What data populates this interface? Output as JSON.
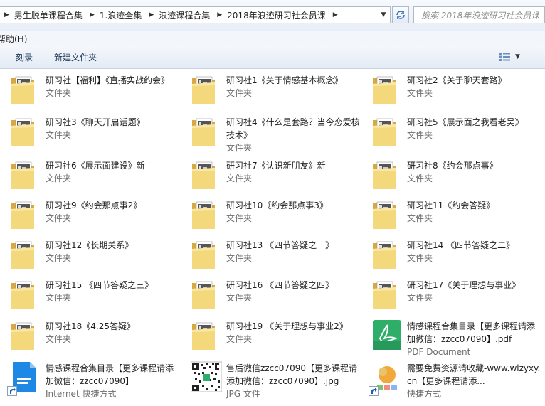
{
  "address_bar": {
    "crumbs": [
      "男生脱单课程合集",
      "1.浪迹全集",
      "浪迹课程合集",
      "2018年浪迹研习社会员课"
    ]
  },
  "search": {
    "placeholder": "搜索 2018年浪迹研习社会员课"
  },
  "menu": {
    "help_label": "帮助(H)"
  },
  "toolbar": {
    "burn_label": "刻录",
    "new_folder_label": "新建文件夹"
  },
  "folder_type": "文件夹",
  "items": [
    {
      "name": "研习社【福利】《直播实战约会》",
      "type": "文件夹",
      "icon": "folder-icon"
    },
    {
      "name": "研习社1《关于情感基本概念》",
      "type": "文件夹",
      "icon": "folder-icon"
    },
    {
      "name": "研习社2《关于聊天套路》",
      "type": "文件夹",
      "icon": "folder-icon"
    },
    {
      "name": "研习社3《聊天开启话题》",
      "type": "文件夹",
      "icon": "folder-icon"
    },
    {
      "name": "研习社4《什么是套路？当今恋爱核技术》",
      "type": "文件夹",
      "icon": "folder-icon"
    },
    {
      "name": "研习社5《展示面之我看老吴》",
      "type": "文件夹",
      "icon": "folder-icon"
    },
    {
      "name": "研习社6《展示面建设》新",
      "type": "文件夹",
      "icon": "folder-icon"
    },
    {
      "name": "研习社7《认识新朋友》新",
      "type": "文件夹",
      "icon": "folder-icon"
    },
    {
      "name": "研习社8《约会那点事》",
      "type": "文件夹",
      "icon": "folder-icon"
    },
    {
      "name": "研习社9《约会那点事2》",
      "type": "文件夹",
      "icon": "folder-icon"
    },
    {
      "name": "研习社10《约会那点事3》",
      "type": "文件夹",
      "icon": "folder-icon"
    },
    {
      "name": "研习社11《约会答疑》",
      "type": "文件夹",
      "icon": "folder-icon"
    },
    {
      "name": "研习社12《长期关系》",
      "type": "文件夹",
      "icon": "folder-icon"
    },
    {
      "name": "研习社13 《四节答疑之一》",
      "type": "文件夹",
      "icon": "folder-icon"
    },
    {
      "name": "研习社14 《四节答疑之二》",
      "type": "文件夹",
      "icon": "folder-icon"
    },
    {
      "name": "研习社15 《四节答疑之三》",
      "type": "文件夹",
      "icon": "folder-icon"
    },
    {
      "name": "研习社16 《四节答疑之四》",
      "type": "文件夹",
      "icon": "folder-icon"
    },
    {
      "name": "研习社17《关于理想与事业》",
      "type": "文件夹",
      "icon": "folder-icon"
    },
    {
      "name": "研习社18《4.25答疑》",
      "type": "文件夹",
      "icon": "folder-icon"
    },
    {
      "name": "研习社19 《关于理想与事业2》",
      "type": "文件夹",
      "icon": "folder-icon"
    },
    {
      "name": "情感课程合集目录【更多课程请添加微信：zzcc07090】.pdf",
      "type": "PDF Document",
      "icon": "pdf-icon"
    },
    {
      "name": "情感课程合集目录【更多课程请添加微信：zzcc07090】",
      "type": "Internet 快捷方式",
      "icon": "internet-shortcut-icon"
    },
    {
      "name": "售后微信zzcc07090【更多课程请添加微信：zzcc07090】.jpg",
      "type": "JPG 文件",
      "icon": "qr-image-icon"
    },
    {
      "name": "需要免费资源请收藏-www.wlzyxy.cn【更多课程请添...",
      "type": "快捷方式",
      "icon": "shortcut-icon"
    }
  ],
  "colors": {
    "folder": "#e8c46a",
    "pdf": "#28b06b",
    "internet": "#1e88e5",
    "accent": "#1e3557"
  }
}
